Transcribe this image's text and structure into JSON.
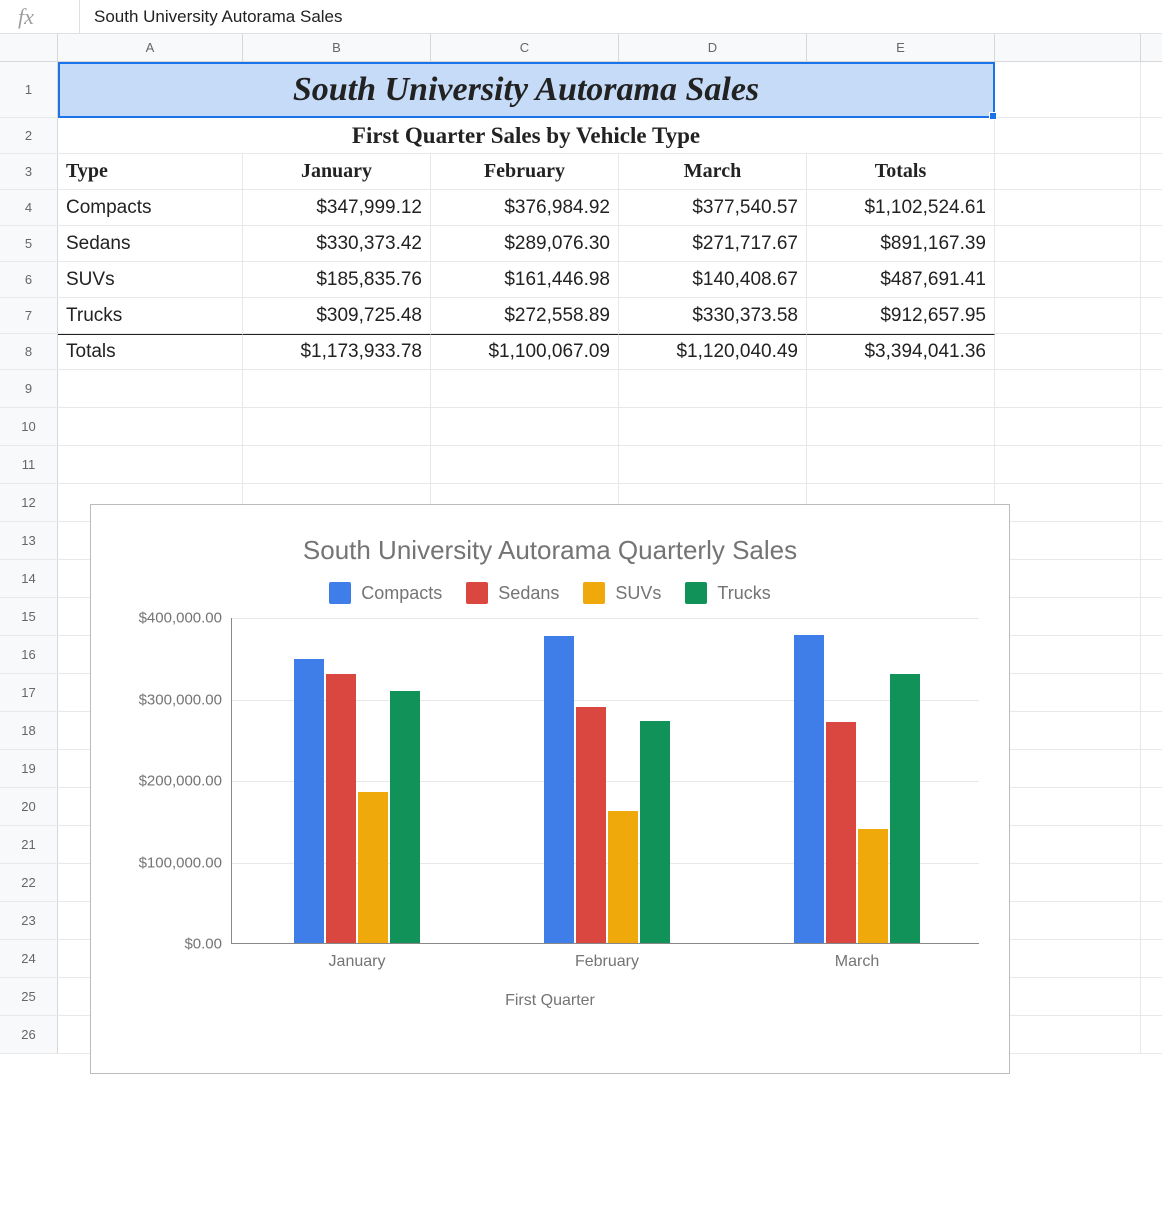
{
  "formula_bar": {
    "fx_label": "fx",
    "content": "South University Autorama Sales"
  },
  "column_headers": [
    "A",
    "B",
    "C",
    "D",
    "E"
  ],
  "row_numbers": [
    1,
    2,
    3,
    4,
    5,
    6,
    7,
    8,
    9,
    10,
    11,
    12,
    13,
    14,
    15,
    16,
    17,
    18,
    19,
    20,
    21,
    22,
    23,
    24,
    25,
    26
  ],
  "title": "South University Autorama Sales",
  "subtitle": "First Quarter Sales by Vehicle Type",
  "headers": {
    "type": "Type",
    "jan": "January",
    "feb": "February",
    "mar": "March",
    "tot": "Totals"
  },
  "rows": [
    {
      "label": "Compacts",
      "jan": "$347,999.12",
      "feb": "$376,984.92",
      "mar": "$377,540.57",
      "tot": "$1,102,524.61"
    },
    {
      "label": "Sedans",
      "jan": "$330,373.42",
      "feb": "$289,076.30",
      "mar": "$271,717.67",
      "tot": "$891,167.39"
    },
    {
      "label": "SUVs",
      "jan": "$185,835.76",
      "feb": "$161,446.98",
      "mar": "$140,408.67",
      "tot": "$487,691.41"
    },
    {
      "label": "Trucks",
      "jan": "$309,725.48",
      "feb": "$272,558.89",
      "mar": "$330,373.58",
      "tot": "$912,657.95"
    }
  ],
  "totals": {
    "label": "Totals",
    "jan": "$1,173,933.78",
    "feb": "$1,100,067.09",
    "mar": "$1,120,040.49",
    "tot": "$3,394,041.36"
  },
  "chart_data": {
    "type": "bar",
    "title": "South University Autorama Quarterly Sales",
    "xlabel": "First Quarter",
    "ylabel": "",
    "categories": [
      "January",
      "February",
      "March"
    ],
    "series": [
      {
        "name": "Compacts",
        "color": "#3f7ee8",
        "values": [
          347999.12,
          376984.92,
          377540.57
        ]
      },
      {
        "name": "Sedans",
        "color": "#d94740",
        "values": [
          330373.42,
          289076.3,
          271717.67
        ]
      },
      {
        "name": "SUVs",
        "color": "#f0a90b",
        "values": [
          185835.76,
          161446.98,
          140408.67
        ]
      },
      {
        "name": "Trucks",
        "color": "#109258",
        "values": [
          309725.48,
          272558.89,
          330373.58
        ]
      }
    ],
    "ylim": [
      0,
      400000
    ],
    "yticks": [
      "$0.00",
      "$100,000.00",
      "$200,000.00",
      "$300,000.00",
      "$400,000.00"
    ]
  }
}
